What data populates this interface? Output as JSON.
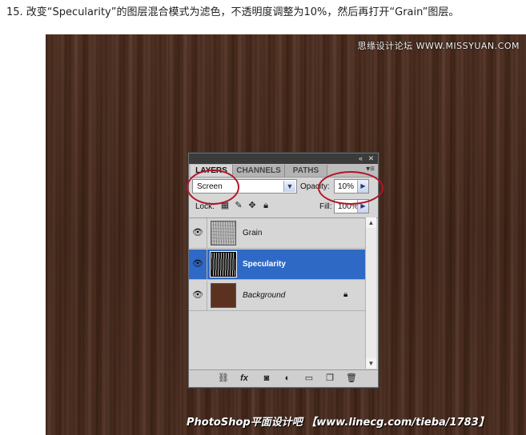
{
  "instruction": "15. 改变“Specularity”的图层混合模式为滤色，不透明度调整为10%，然后再打开“Grain”图层。",
  "watermark_top": "思缘设计论坛 WWW.MISSYUAN.COM",
  "watermark_bottom": "PhotoShop平面设计吧 【www.linecg.com/tieba/1783】",
  "panel": {
    "tabs": [
      "LAYERS",
      "CHANNELS",
      "PATHS"
    ],
    "active_tab": "LAYERS",
    "blend_mode": "Screen",
    "opacity_label": "Opacity:",
    "opacity_value": "10%",
    "lock_label": "Lock:",
    "fill_label": "Fill:",
    "fill_value": "100%",
    "layers": [
      {
        "name": "Grain",
        "visible": true,
        "selected": false
      },
      {
        "name": "Specularity",
        "visible": true,
        "selected": true
      },
      {
        "name": "Background",
        "visible": true,
        "selected": false,
        "locked": true
      }
    ],
    "footer_icons": [
      "link-icon",
      "fx-icon",
      "mask-icon",
      "adjustment-icon",
      "group-icon",
      "new-layer-icon",
      "trash-icon"
    ]
  },
  "colors": {
    "selected_row": "#2f69c6",
    "callout": "#b0162a",
    "wood": "#4a2b1d"
  }
}
